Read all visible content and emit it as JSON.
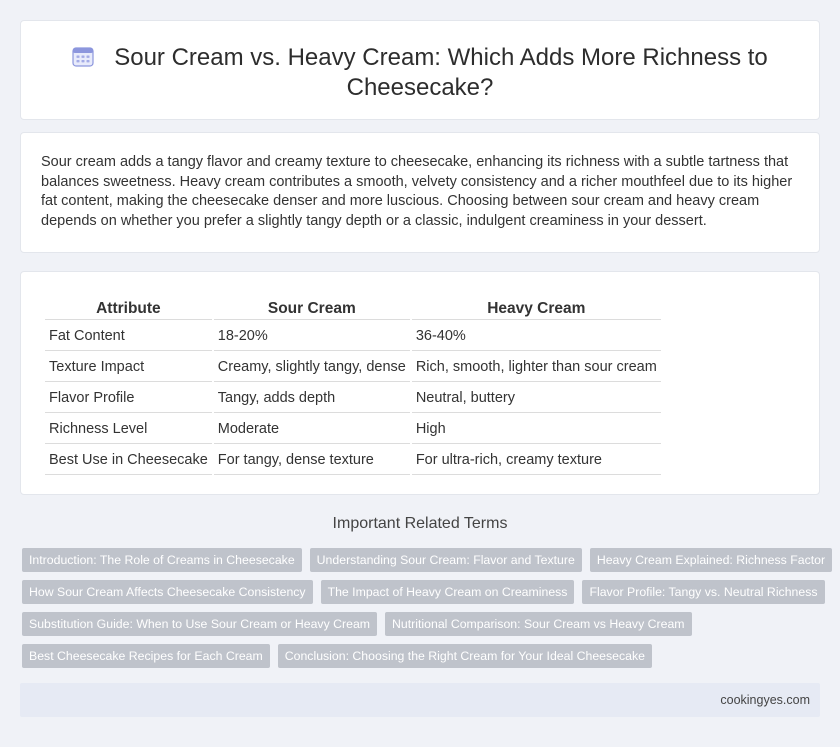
{
  "header": {
    "title": "Sour Cream vs. Heavy Cream: Which Adds More Richness to Cheesecake?",
    "icon": "calendar-icon"
  },
  "intro": {
    "text": "Sour cream adds a tangy flavor and creamy texture to cheesecake, enhancing its richness with a subtle tartness that balances sweetness. Heavy cream contributes a smooth, velvety consistency and a richer mouthfeel due to its higher fat content, making the cheesecake denser and more luscious. Choosing between sour cream and heavy cream depends on whether you prefer a slightly tangy depth or a classic, indulgent creaminess in your dessert."
  },
  "table": {
    "headers": [
      "Attribute",
      "Sour Cream",
      "Heavy Cream"
    ],
    "rows": [
      [
        "Fat Content",
        "18-20%",
        "36-40%"
      ],
      [
        "Texture Impact",
        "Creamy, slightly tangy, dense",
        "Rich, smooth, lighter than sour cream"
      ],
      [
        "Flavor Profile",
        "Tangy, adds depth",
        "Neutral, buttery"
      ],
      [
        "Richness Level",
        "Moderate",
        "High"
      ],
      [
        "Best Use in Cheesecake",
        "For tangy, dense texture",
        "For ultra-rich, creamy texture"
      ]
    ]
  },
  "related": {
    "heading": "Important Related Terms",
    "rows": [
      [
        "Introduction: The Role of Creams in Cheesecake",
        "Understanding Sour Cream: Flavor and Texture",
        "Heavy Cream Explained: Richness Factor"
      ],
      [
        "How Sour Cream Affects Cheesecake Consistency",
        "The Impact of Heavy Cream on Creaminess",
        "Flavor Profile: Tangy vs. Neutral Richness"
      ],
      [
        "Substitution Guide: When to Use Sour Cream or Heavy Cream",
        "Nutritional Comparison: Sour Cream vs Heavy Cream"
      ],
      [
        "Best Cheesecake Recipes for Each Cream",
        "Conclusion: Choosing the Right Cream for Your Ideal Cheesecake"
      ]
    ]
  },
  "footer": {
    "site": "cookingyes.com"
  },
  "colors": {
    "background": "#f0f2f7",
    "tag": "#bfc3cb",
    "footer": "#e6eaf4",
    "icon": "#7b86d6"
  }
}
